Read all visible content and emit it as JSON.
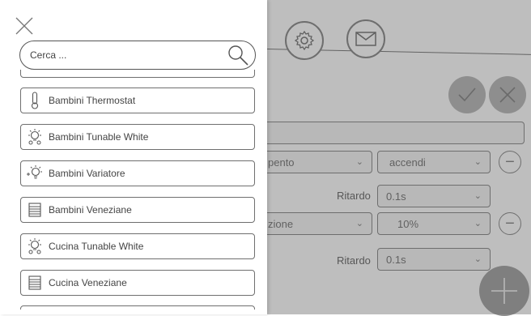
{
  "drawer": {
    "search": {
      "placeholder": "Cerca ..."
    },
    "items": [
      {
        "label": "Bambini Thermostat",
        "icon": "thermometer-icon"
      },
      {
        "label": "Bambini Tunable White",
        "icon": "tunable-white-bulb-icon"
      },
      {
        "label": "Bambini Variatore",
        "icon": "dimmer-bulb-icon"
      },
      {
        "label": "Bambini Veneziane",
        "icon": "blinds-icon"
      },
      {
        "label": "Cucina Tunable White",
        "icon": "tunable-white-bulb-icon"
      },
      {
        "label": "Cucina Veneziane",
        "icon": "blinds-icon"
      }
    ]
  },
  "background": {
    "row1": {
      "left_value": "pento",
      "right_value": "accendi"
    },
    "delay1": {
      "label": "Ritardo",
      "value": "0.1s"
    },
    "row2": {
      "left_value": "zione",
      "right_value": "10%"
    },
    "delay2": {
      "label": "Ritardo",
      "value": "0.1s"
    }
  }
}
